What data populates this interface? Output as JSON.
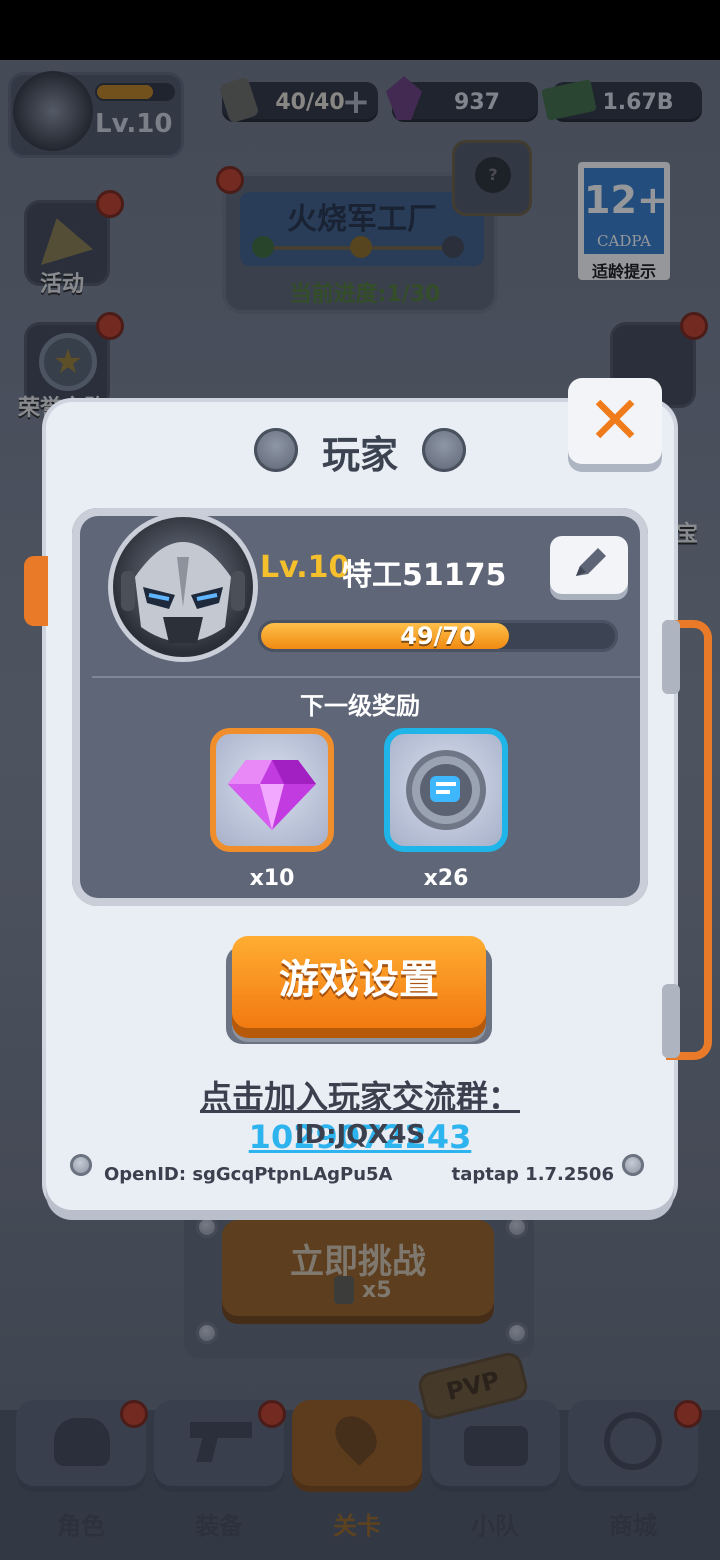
{
  "hud": {
    "player_level": "Lv.10",
    "energy": "40/40",
    "gems": "937",
    "cash": "1.67B"
  },
  "stage_card": {
    "name": "火烧军工厂",
    "progress": "当前进度:1/30"
  },
  "age_rating": {
    "age": "12+",
    "org": "CADPA",
    "label": "适龄提示"
  },
  "side_menu": {
    "activity": "活动",
    "honor": "荣誉之路",
    "right_partial_1": "宝"
  },
  "challenge": {
    "label": "立即挑战",
    "cost": "x5"
  },
  "bottom_nav": {
    "tabs": [
      "角色",
      "装备",
      "关卡",
      "小队",
      "商城"
    ],
    "active_index": 2,
    "pvp_badge": "PVP"
  },
  "player_modal": {
    "title": "玩家",
    "level": "Lv.10",
    "name": "特工51175",
    "xp": {
      "text": "49/70",
      "current": 49,
      "max": 70
    },
    "next_reward_label": "下一级奖励",
    "rewards": [
      {
        "icon": "purple-gem-icon",
        "count": "x10"
      },
      {
        "icon": "fist-token-icon",
        "count": "x26"
      }
    ],
    "settings_button": "游戏设置",
    "join_group_label": "点击加入玩家交流群：",
    "join_group_number": "1029072243",
    "id": "ID:JQX4S",
    "openid": "OpenID: sgGcqPtpnLAgPu5A",
    "version": "taptap 1.7.2506",
    "close_icon": "close-icon"
  }
}
